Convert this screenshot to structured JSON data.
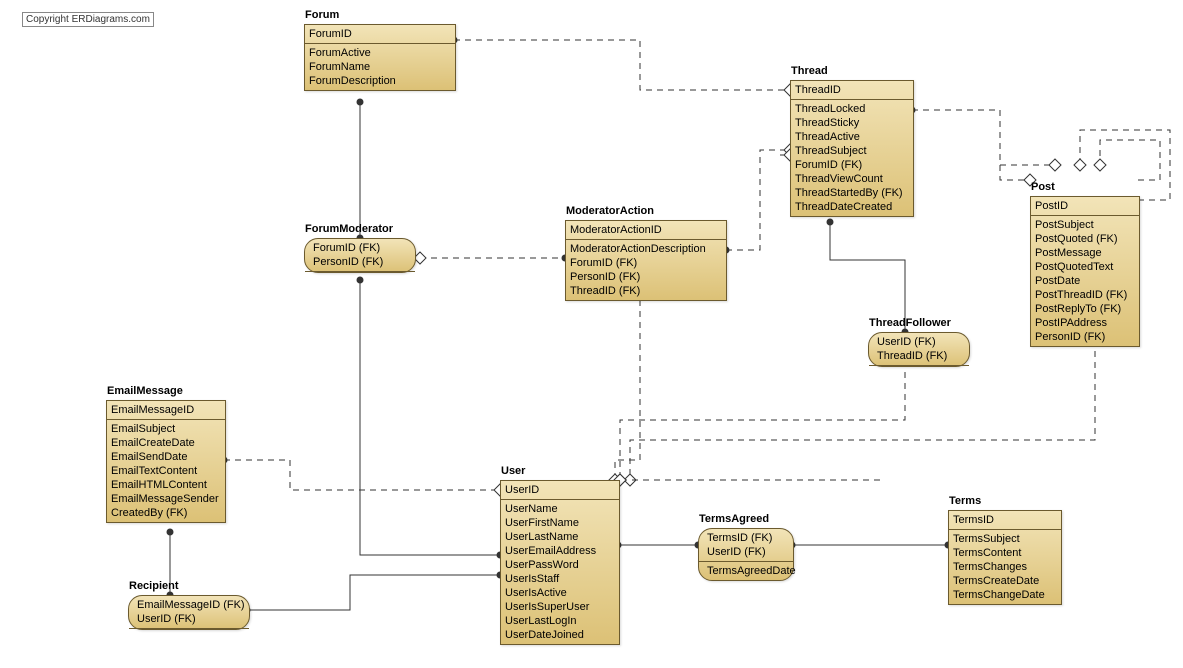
{
  "copyright": "Copyright ERDiagrams.com",
  "entities": {
    "forum": {
      "title": "Forum",
      "keys": [
        "ForumID"
      ],
      "attrs": [
        "ForumActive",
        "ForumName",
        "ForumDescription"
      ]
    },
    "thread": {
      "title": "Thread",
      "keys": [
        "ThreadID"
      ],
      "attrs": [
        "ThreadLocked",
        "ThreadSticky",
        "ThreadActive",
        "ThreadSubject",
        "ForumID (FK)",
        "ThreadViewCount",
        "ThreadStartedBy (FK)",
        "ThreadDateCreated"
      ]
    },
    "post": {
      "title": "Post",
      "keys": [
        "PostID"
      ],
      "attrs": [
        "PostSubject",
        "PostQuoted (FK)",
        "PostMessage",
        "PostQuotedText",
        "PostDate",
        "PostThreadID (FK)",
        "PostReplyTo (FK)",
        "PostIPAddress",
        "PersonID (FK)"
      ]
    },
    "moderatoraction": {
      "title": "ModeratorAction",
      "keys": [
        "ModeratorActionID"
      ],
      "attrs": [
        "ModeratorActionDescription",
        "ForumID (FK)",
        "PersonID (FK)",
        "ThreadID (FK)"
      ]
    },
    "emailmessage": {
      "title": "EmailMessage",
      "keys": [
        "EmailMessageID"
      ],
      "attrs": [
        "EmailSubject",
        "EmailCreateDate",
        "EmailSendDate",
        "EmailTextContent",
        "EmailHTMLContent",
        "EmailMessageSender",
        "CreatedBy (FK)"
      ]
    },
    "user": {
      "title": "User",
      "keys": [
        "UserID"
      ],
      "attrs": [
        "UserName",
        "UserFirstName",
        "UserLastName",
        "UserEmailAddress",
        "UserPassWord",
        "UserIsStaff",
        "UserIsActive",
        "UserIsSuperUser",
        "UserLastLogIn",
        "UserDateJoined"
      ]
    },
    "terms": {
      "title": "Terms",
      "keys": [
        "TermsID"
      ],
      "attrs": [
        "TermsSubject",
        "TermsContent",
        "TermsChanges",
        "TermsCreateDate",
        "TermsChangeDate"
      ]
    }
  },
  "assocs": {
    "forummoderator": {
      "title": "ForumModerator",
      "keys": [
        "ForumID (FK)",
        "PersonID (FK)"
      ],
      "attrs": []
    },
    "threadfollower": {
      "title": "ThreadFollower",
      "keys": [
        "UserID (FK)",
        "ThreadID (FK)"
      ],
      "attrs": []
    },
    "recipient": {
      "title": "Recipient",
      "keys": [
        "EmailMessageID (FK)",
        "UserID (FK)"
      ],
      "attrs": []
    },
    "termsagreed": {
      "title": "TermsAgreed",
      "keys": [
        "TermsID (FK)",
        "UserID (FK)"
      ],
      "attrs": [
        "TermsAgreedDate"
      ]
    }
  },
  "colors": {
    "line": "#333333"
  }
}
